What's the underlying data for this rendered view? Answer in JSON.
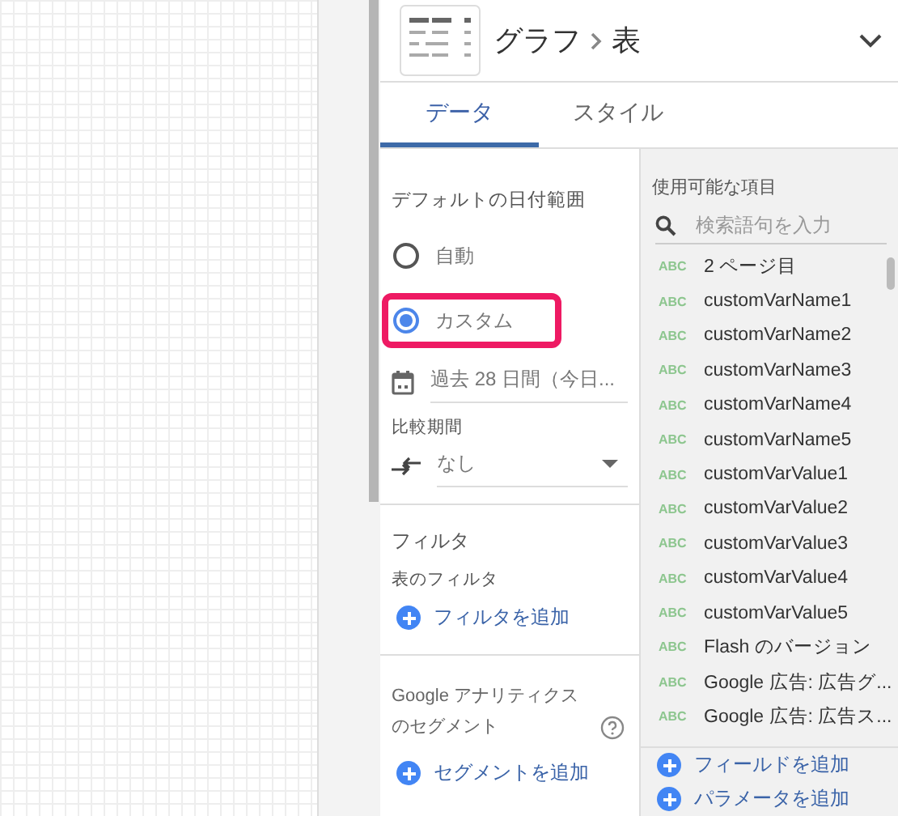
{
  "header": {
    "breadcrumb": [
      "グラフ",
      "表"
    ]
  },
  "tabs": [
    {
      "label": "データ",
      "selected": true
    },
    {
      "label": "スタイル",
      "selected": false
    }
  ],
  "date_range": {
    "heading": "デフォルトの日付範囲",
    "options": [
      {
        "label": "自動",
        "selected": false,
        "highlighted": false
      },
      {
        "label": "カスタム",
        "selected": true,
        "highlighted": true
      }
    ],
    "value": "過去 28 日間（今日..."
  },
  "comparison": {
    "label": "比較期間",
    "value": "なし"
  },
  "filter": {
    "heading": "フィルタ",
    "label": "表のフィルタ",
    "add": "フィルタを追加"
  },
  "segment": {
    "heading": "Google アナリティクスのセグメント",
    "add": "セグメントを追加"
  },
  "fields": {
    "heading": "使用可能な項目",
    "search_placeholder": "検索語句を入力",
    "items": [
      {
        "type": "ABC",
        "name": "2 ページ目"
      },
      {
        "type": "ABC",
        "name": "customVarName1"
      },
      {
        "type": "ABC",
        "name": "customVarName2"
      },
      {
        "type": "ABC",
        "name": "customVarName3"
      },
      {
        "type": "ABC",
        "name": "customVarName4"
      },
      {
        "type": "ABC",
        "name": "customVarName5"
      },
      {
        "type": "ABC",
        "name": "customVarValue1"
      },
      {
        "type": "ABC",
        "name": "customVarValue2"
      },
      {
        "type": "ABC",
        "name": "customVarValue3"
      },
      {
        "type": "ABC",
        "name": "customVarValue4"
      },
      {
        "type": "ABC",
        "name": "customVarValue5"
      },
      {
        "type": "ABC",
        "name": "Flash のバージョン"
      },
      {
        "type": "ABC",
        "name": "Google 広告: 広告グ..."
      },
      {
        "type": "ABC",
        "name": "Google 広告: 広告ス..."
      }
    ],
    "actions": [
      "フィールドを追加",
      "パラメータを追加"
    ]
  }
}
